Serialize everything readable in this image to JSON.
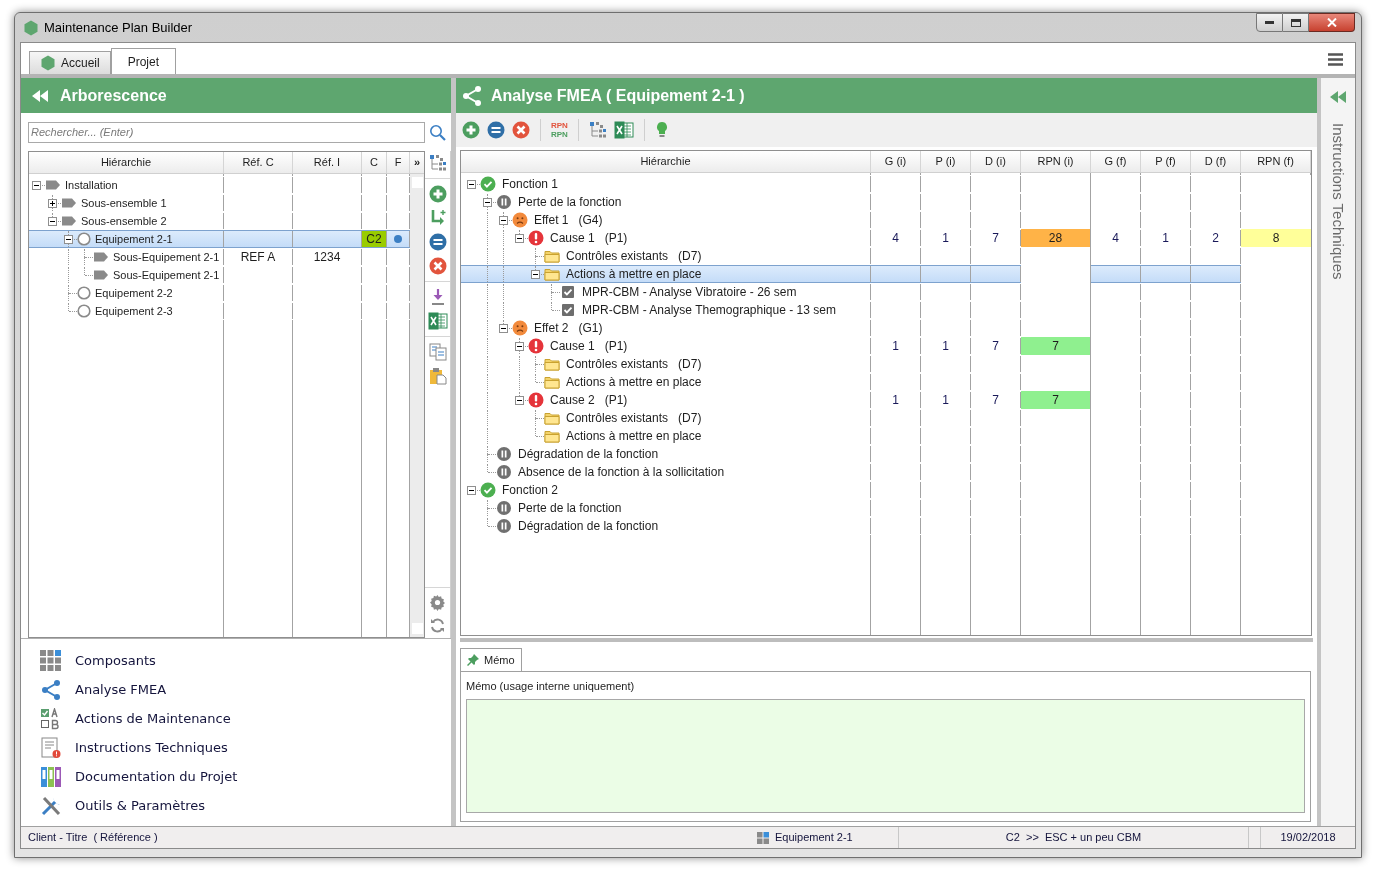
{
  "window": {
    "title": "Maintenance Plan Builder"
  },
  "tabs": [
    {
      "label": "Accueil",
      "selected": false,
      "kind": "home"
    },
    {
      "label": "Projet",
      "selected": true,
      "kind": "plain"
    }
  ],
  "left_panel": {
    "title": "Arborescence",
    "search": {
      "placeholder": "Rechercher... (Enter)"
    },
    "tree": {
      "columns": [
        "Hiérarchie",
        "Réf. C",
        "Réf. I",
        "C",
        "F",
        "»"
      ],
      "rows": [
        {
          "label": "Installation",
          "kind": "group",
          "expanded": true,
          "selected": false,
          "children": [
            {
              "label": "Sous-ensemble 1",
              "kind": "group",
              "expanded": false,
              "selected": false
            },
            {
              "label": "Sous-ensemble 2",
              "kind": "group",
              "expanded": true,
              "selected": false,
              "children": [
                {
                  "label": "Equipement 2-1",
                  "kind": "equipment",
                  "expanded": true,
                  "selected": true,
                  "c": {
                    "text": "C2",
                    "color": "#99cc00"
                  },
                  "flagged": true,
                  "children": [
                    {
                      "label": "Sous-Equipement 2-1",
                      "kind": "sub",
                      "selected": false,
                      "ref_c": "REF A",
                      "ref_i": "1234"
                    },
                    {
                      "label": "Sous-Equipement 2-1",
                      "kind": "sub",
                      "selected": false
                    }
                  ]
                },
                {
                  "label": "Equipement 2-2",
                  "kind": "equipment",
                  "selected": false
                },
                {
                  "label": "Equipement 2-3",
                  "kind": "equipment",
                  "selected": false
                }
              ]
            }
          ]
        }
      ]
    }
  },
  "nav": [
    {
      "label": "Composants",
      "kind": "grid"
    },
    {
      "label": "Analyse FMEA",
      "kind": "share"
    },
    {
      "label": "Actions de Maintenance",
      "kind": "checklist"
    },
    {
      "label": "Instructions Techniques",
      "kind": "document"
    },
    {
      "label": "Documentation du Projet",
      "kind": "binders"
    },
    {
      "label": "Outils & Paramètres",
      "kind": "tools"
    }
  ],
  "fmea": {
    "title": "Analyse FMEA ( Equipement 2-1 )",
    "toolbar": {
      "rpn_labels": [
        "RPN",
        "RPN"
      ]
    },
    "columns": [
      "Hiérarchie",
      "G (i)",
      "P (i)",
      "D (i)",
      "RPN (i)",
      "G (f)",
      "P (f)",
      "D (f)",
      "RPN (f)"
    ],
    "rows": [
      {
        "label": "Fonction 1",
        "kind": "function",
        "expanded": true,
        "selected": false,
        "children": [
          {
            "label": "Perte de la fonction",
            "kind": "mode",
            "expanded": true,
            "selected": false,
            "children": [
              {
                "label": "Effet 1   (G4)",
                "kind": "effect",
                "expanded": true,
                "selected": false,
                "children": [
                  {
                    "label": "Cause 1   (P1)",
                    "kind": "cause",
                    "expanded": true,
                    "selected": false,
                    "values": [
                      "4",
                      "1",
                      "7",
                      "4",
                      "1",
                      "2"
                    ],
                    "rpn_i": {
                      "text": "28",
                      "color": "#ffb347"
                    },
                    "rpn_f": {
                      "text": "8",
                      "color": "#ffff99"
                    },
                    "children": [
                      {
                        "label": "Contrôles existants   (D7)",
                        "kind": "folder",
                        "selected": false
                      },
                      {
                        "label": "Actions à mettre en place",
                        "kind": "folder",
                        "expanded": true,
                        "selected": true,
                        "children": [
                          {
                            "label": "MPR-CBM - Analyse Vibratoire - 26 sem",
                            "kind": "action",
                            "selected": false
                          },
                          {
                            "label": "MPR-CBM - Analyse Themographique - 13 sem",
                            "kind": "action",
                            "selected": false
                          }
                        ]
                      }
                    ]
                  }
                ]
              },
              {
                "label": "Effet 2   (G1)",
                "kind": "effect",
                "expanded": true,
                "selected": false,
                "children": [
                  {
                    "label": "Cause 1   (P1)",
                    "kind": "cause",
                    "expanded": true,
                    "selected": false,
                    "values": [
                      "1",
                      "1",
                      "7"
                    ],
                    "rpn_i": {
                      "text": "7",
                      "color": "#8ff08f"
                    },
                    "children": [
                      {
                        "label": "Contrôles existants   (D7)",
                        "kind": "folder",
                        "selected": false
                      },
                      {
                        "label": "Actions à mettre en place",
                        "kind": "folder",
                        "selected": false
                      }
                    ]
                  },
                  {
                    "label": "Cause 2   (P1)",
                    "kind": "cause",
                    "expanded": true,
                    "selected": false,
                    "values": [
                      "1",
                      "1",
                      "7"
                    ],
                    "rpn_i": {
                      "text": "7",
                      "color": "#8ff08f"
                    },
                    "children": [
                      {
                        "label": "Contrôles existants   (D7)",
                        "kind": "folder",
                        "selected": false
                      },
                      {
                        "label": "Actions à mettre en place",
                        "kind": "folder",
                        "selected": false
                      }
                    ]
                  }
                ]
              }
            ]
          },
          {
            "label": "Dégradation de la fonction",
            "kind": "mode",
            "selected": false
          },
          {
            "label": "Absence de la fonction à la sollicitation",
            "kind": "mode",
            "selected": false
          }
        ]
      },
      {
        "label": "Fonction 2",
        "kind": "function",
        "expanded": true,
        "selected": false,
        "children": [
          {
            "label": "Perte de la fonction",
            "kind": "mode",
            "selected": false
          },
          {
            "label": "Dégradation de la fonction",
            "kind": "mode",
            "selected": false
          }
        ]
      }
    ]
  },
  "memo": {
    "tab": "Mémo",
    "label": "Mémo (usage interne uniquement)"
  },
  "side_panel": {
    "title": "Instructions Techniques"
  },
  "status_bar": {
    "project": "Client - Titre  ( Référence )",
    "item": "Equipement 2-1",
    "criticality": "C2  >>  ESC + un peu CBM",
    "date": "19/02/2018"
  }
}
